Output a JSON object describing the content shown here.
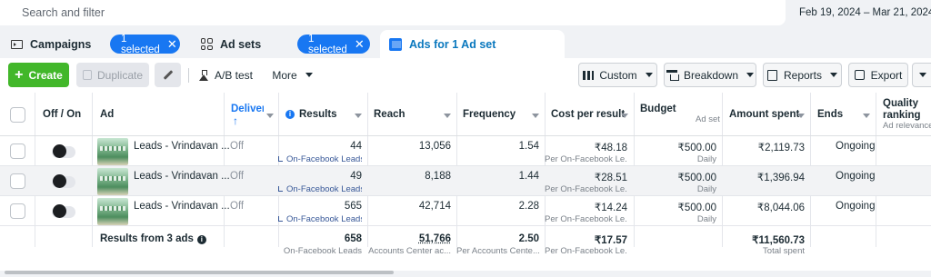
{
  "search": {
    "placeholder": "Search and filter"
  },
  "date_range": "Feb 19, 2024 – Mar 21, 2024",
  "tabs": [
    {
      "label": "Campaigns",
      "pill": "1 selected"
    },
    {
      "label": "Ad sets",
      "pill": "1 selected"
    },
    {
      "label": "Ads for 1 Ad set"
    }
  ],
  "toolbar": {
    "create": "Create",
    "duplicate": "Duplicate",
    "ab_test": "A/B test",
    "more": "More",
    "custom": "Custom",
    "breakdown": "Breakdown",
    "reports": "Reports",
    "export": "Export"
  },
  "columns": {
    "off_on": "Off / On",
    "ad": "Ad",
    "delivery": "Delivery",
    "results": "Results",
    "reach": "Reach",
    "frequency": "Frequency",
    "cost_per_result": "Cost per result",
    "budget": "Budget",
    "budget_sub": "Ad set",
    "amount_spent": "Amount spent",
    "ends": "Ends",
    "quality_ranking": "Quality ranking",
    "quality_sub": "Ad relevance ..."
  },
  "rows": [
    {
      "ad": "Leads - Vrindavan ...",
      "delivery": "Off",
      "results": "44",
      "results_sub": "On-Facebook Leads",
      "reach": "13,056",
      "frequency": "1.54",
      "cpr": "₹48.18",
      "cpr_sub": "Per On-Facebook Le...",
      "budget": "₹500.00",
      "budget_sub": "Daily",
      "spent": "₹2,119.73",
      "ends": "Ongoing"
    },
    {
      "ad": "Leads - Vrindavan ...",
      "delivery": "Off",
      "results": "49",
      "results_sub": "On-Facebook Leads",
      "reach": "8,188",
      "frequency": "1.44",
      "cpr": "₹28.51",
      "cpr_sub": "Per On-Facebook Le...",
      "budget": "₹500.00",
      "budget_sub": "Daily",
      "spent": "₹1,396.94",
      "ends": "Ongoing"
    },
    {
      "ad": "Leads - Vrindavan ...",
      "delivery": "Off",
      "results": "565",
      "results_sub": "On-Facebook Leads",
      "reach": "42,714",
      "frequency": "2.28",
      "cpr": "₹14.24",
      "cpr_sub": "Per On-Facebook Le...",
      "budget": "₹500.00",
      "budget_sub": "Daily",
      "spent": "₹8,044.06",
      "ends": "Ongoing"
    }
  ],
  "totals": {
    "label": "Results from 3 ads",
    "results": "658",
    "results_sub": "On-Facebook Leads",
    "reach": "51,766",
    "reach_sub": "Accounts Center ac...",
    "frequency": "2.50",
    "frequency_sub": "Per Accounts Cente...",
    "cpr": "₹17.57",
    "cpr_sub": "Per On-Facebook Le...",
    "spent": "₹11,560.73",
    "spent_sub": "Total spent"
  },
  "colors": {
    "accent": "#1877f2",
    "create": "#42b72a",
    "link": "#385898"
  }
}
